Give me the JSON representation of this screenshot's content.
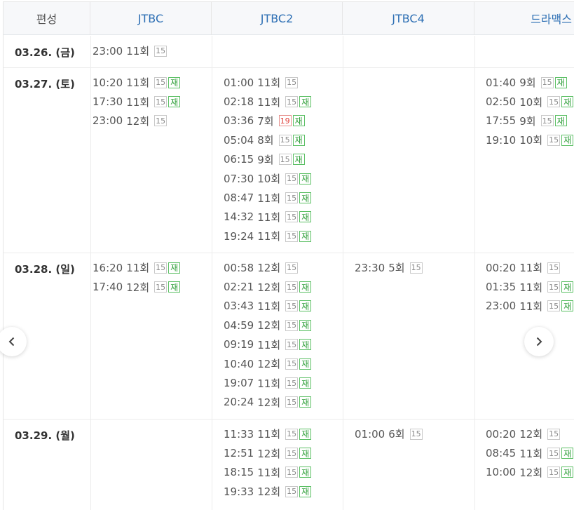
{
  "header": {
    "label": "편성",
    "channels": [
      "JTBC",
      "JTBC2",
      "JTBC4",
      "드라맥스"
    ]
  },
  "rows": [
    {
      "date": "03.26. (금)",
      "cells": [
        [
          {
            "time": "23:00",
            "ep": "11회",
            "rating": "15",
            "rerun": ""
          }
        ],
        [],
        [],
        []
      ]
    },
    {
      "date": "03.27. (토)",
      "cells": [
        [
          {
            "time": "10:20",
            "ep": "11회",
            "rating": "15",
            "rerun": "재"
          },
          {
            "time": "17:30",
            "ep": "11회",
            "rating": "15",
            "rerun": "재"
          },
          {
            "time": "23:00",
            "ep": "12회",
            "rating": "15",
            "rerun": ""
          }
        ],
        [
          {
            "time": "01:00",
            "ep": "11회",
            "rating": "15",
            "rerun": ""
          },
          {
            "time": "02:18",
            "ep": "11회",
            "rating": "15",
            "rerun": "재"
          },
          {
            "time": "03:36",
            "ep": "7회",
            "rating": "19",
            "rerun": "재"
          },
          {
            "time": "05:04",
            "ep": "8회",
            "rating": "15",
            "rerun": "재"
          },
          {
            "time": "06:15",
            "ep": "9회",
            "rating": "15",
            "rerun": "재"
          },
          {
            "time": "07:30",
            "ep": "10회",
            "rating": "15",
            "rerun": "재"
          },
          {
            "time": "08:47",
            "ep": "11회",
            "rating": "15",
            "rerun": "재"
          },
          {
            "time": "14:32",
            "ep": "11회",
            "rating": "15",
            "rerun": "재"
          },
          {
            "time": "19:24",
            "ep": "11회",
            "rating": "15",
            "rerun": "재"
          }
        ],
        [],
        [
          {
            "time": "01:40",
            "ep": "9회",
            "rating": "15",
            "rerun": "재"
          },
          {
            "time": "02:50",
            "ep": "10회",
            "rating": "15",
            "rerun": "재"
          },
          {
            "time": "17:55",
            "ep": "9회",
            "rating": "15",
            "rerun": "재"
          },
          {
            "time": "19:10",
            "ep": "10회",
            "rating": "15",
            "rerun": "재"
          }
        ]
      ]
    },
    {
      "date": "03.28. (일)",
      "cells": [
        [
          {
            "time": "16:20",
            "ep": "11회",
            "rating": "15",
            "rerun": "재"
          },
          {
            "time": "17:40",
            "ep": "12회",
            "rating": "15",
            "rerun": "재"
          }
        ],
        [
          {
            "time": "00:58",
            "ep": "12회",
            "rating": "15",
            "rerun": ""
          },
          {
            "time": "02:21",
            "ep": "12회",
            "rating": "15",
            "rerun": "재"
          },
          {
            "time": "03:43",
            "ep": "11회",
            "rating": "15",
            "rerun": "재"
          },
          {
            "time": "04:59",
            "ep": "12회",
            "rating": "15",
            "rerun": "재"
          },
          {
            "time": "09:19",
            "ep": "11회",
            "rating": "15",
            "rerun": "재"
          },
          {
            "time": "10:40",
            "ep": "12회",
            "rating": "15",
            "rerun": "재"
          },
          {
            "time": "19:07",
            "ep": "11회",
            "rating": "15",
            "rerun": "재"
          },
          {
            "time": "20:24",
            "ep": "12회",
            "rating": "15",
            "rerun": "재"
          }
        ],
        [
          {
            "time": "23:30",
            "ep": "5회",
            "rating": "15",
            "rerun": ""
          }
        ],
        [
          {
            "time": "00:20",
            "ep": "11회",
            "rating": "15",
            "rerun": ""
          },
          {
            "time": "01:35",
            "ep": "11회",
            "rating": "15",
            "rerun": "재"
          },
          {
            "time": "23:00",
            "ep": "11회",
            "rating": "15",
            "rerun": "재"
          }
        ]
      ]
    },
    {
      "date": "03.29. (월)",
      "cells": [
        [],
        [
          {
            "time": "11:33",
            "ep": "11회",
            "rating": "15",
            "rerun": "재"
          },
          {
            "time": "12:51",
            "ep": "12회",
            "rating": "15",
            "rerun": "재"
          },
          {
            "time": "18:15",
            "ep": "11회",
            "rating": "15",
            "rerun": "재"
          },
          {
            "time": "19:33",
            "ep": "12회",
            "rating": "15",
            "rerun": "재"
          }
        ],
        [
          {
            "time": "01:00",
            "ep": "6회",
            "rating": "15",
            "rerun": ""
          }
        ],
        [
          {
            "time": "00:20",
            "ep": "12회",
            "rating": "15",
            "rerun": ""
          },
          {
            "time": "08:45",
            "ep": "11회",
            "rating": "15",
            "rerun": "재"
          },
          {
            "time": "10:00",
            "ep": "12회",
            "rating": "15",
            "rerun": "재"
          }
        ]
      ]
    }
  ],
  "nav": {
    "prev_icon": "chevron-left-icon",
    "next_icon": "chevron-right-icon"
  },
  "colors": {
    "channel_header": "#2d6fb4",
    "badge_19": "#e0403a",
    "badge_rerun": "#2a9d35",
    "badge_rating": "#8a8a8a"
  }
}
